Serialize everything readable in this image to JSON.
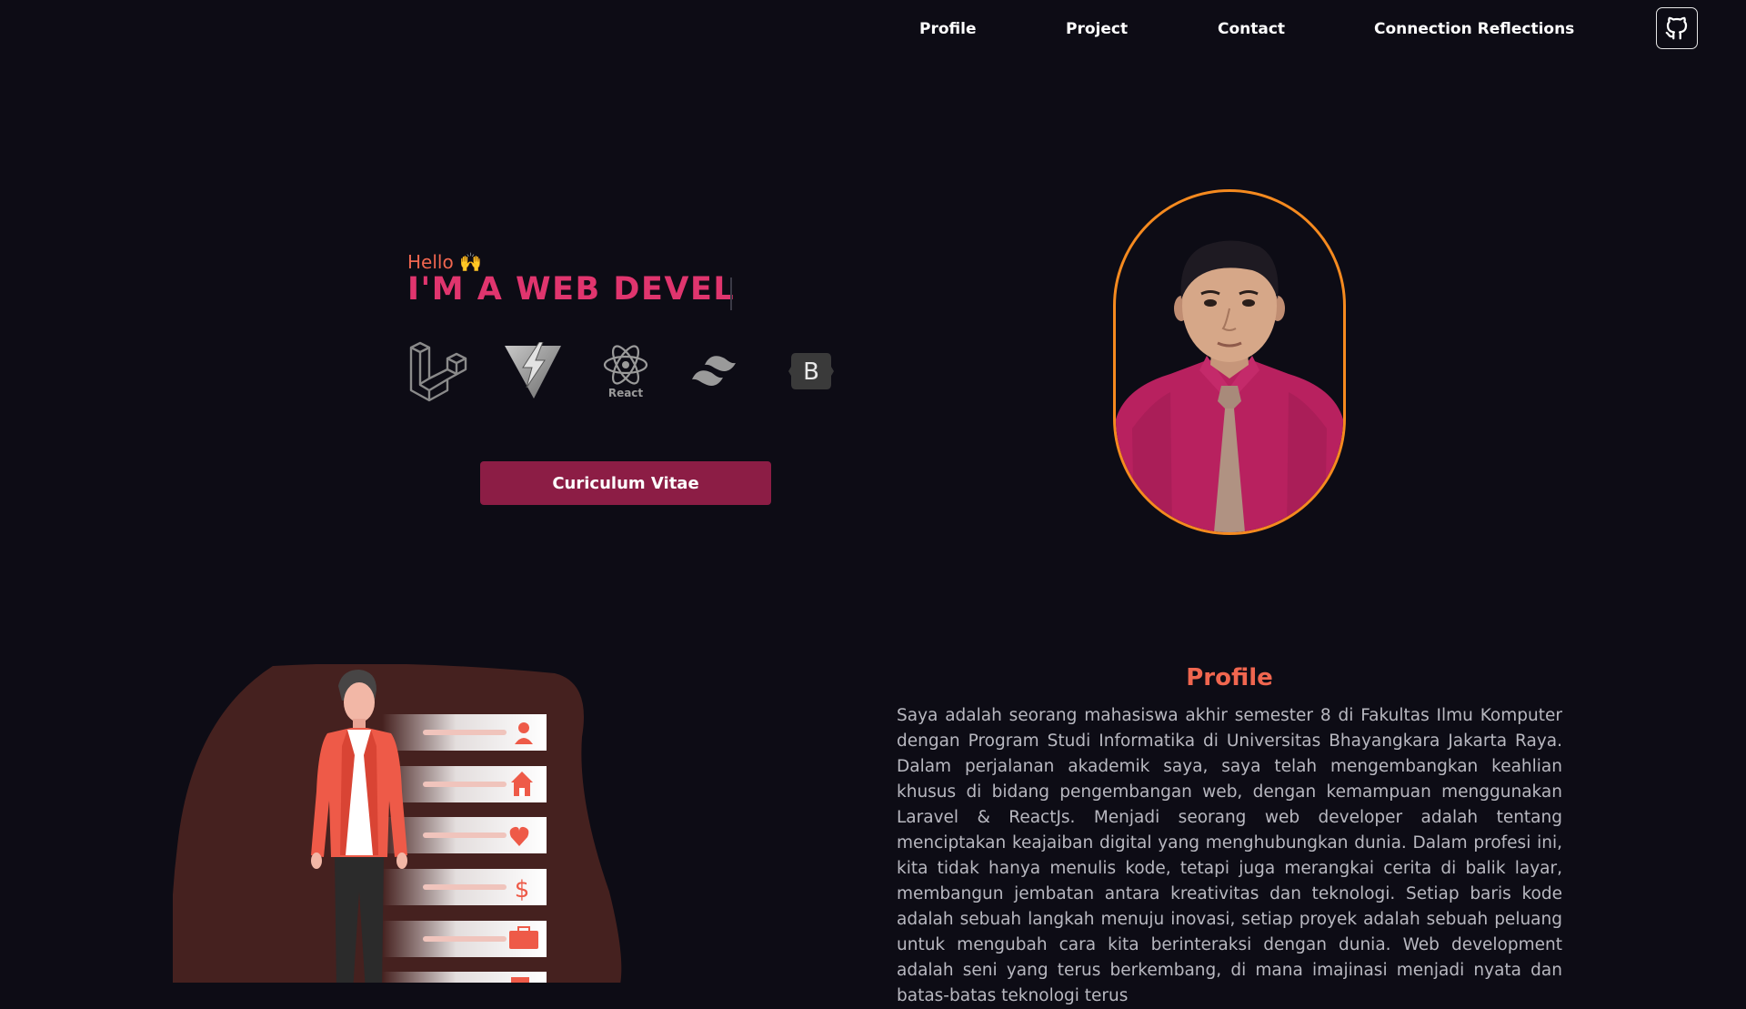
{
  "nav": {
    "items": [
      "Profile",
      "Project",
      "Contact",
      "Connection Reflections"
    ],
    "github_icon": "github-icon"
  },
  "hero": {
    "greeting": "Hello 🙌",
    "headline": "I'M A WEB DEVEL",
    "tech_icons": [
      "laravel-icon",
      "vite-icon",
      "react-icon",
      "tailwind-icon",
      "bootstrap-icon"
    ],
    "react_label": "React",
    "bootstrap_letter": "B",
    "cv_button": "Curiculum Vitae"
  },
  "profile": {
    "title": "Profile",
    "text": "Saya adalah seorang mahasiswa akhir semester 8 di Fakultas Ilmu Komputer dengan Program Studi Informatika di Universitas Bhayangkara Jakarta Raya. Dalam perjalanan akademik saya, saya telah mengembangkan keahlian khusus di bidang pengembangan web, dengan kemampuan menggunakan Laravel & ReactJs. Menjadi seorang web developer adalah tentang menciptakan keajaiban digital yang menghubungkan dunia. Dalam profesi ini, kita tidak hanya menulis kode, tetapi juga merangkai cerita di balik layar, membangun jembatan antara kreativitas dan teknologi. Setiap baris kode adalah sebuah langkah menuju inovasi, setiap proyek adalah sebuah peluang untuk mengubah cara kita berinteraksi dengan dunia. Web development adalah seni yang terus berkembang, di mana imajinasi menjadi nyata dan batas-batas teknologi terus"
  },
  "colors": {
    "background": "#0d0c15",
    "accent_orange": "#f0664f",
    "headline_pink": "#e0356e",
    "cv_button": "#8c1d45",
    "portrait_ring": "#f58a1f"
  }
}
